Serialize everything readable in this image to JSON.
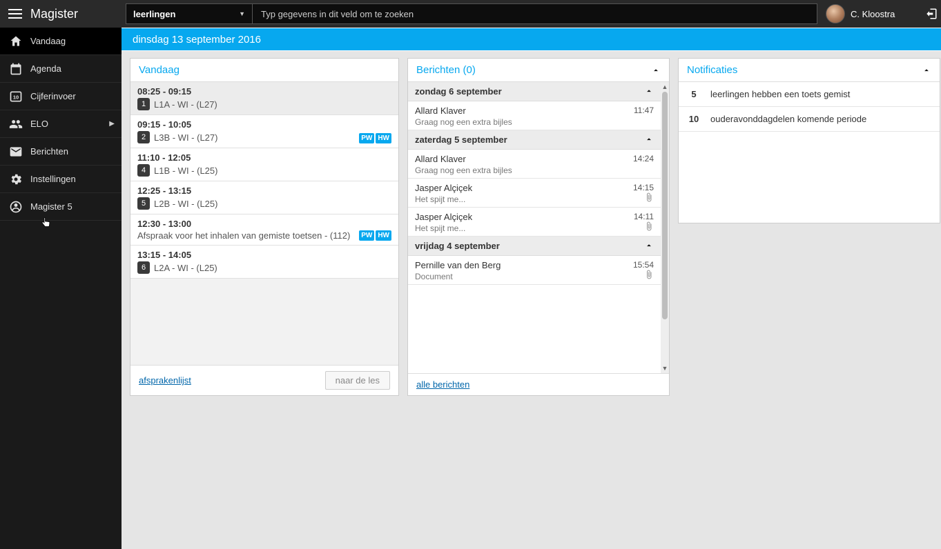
{
  "brand": "Magister",
  "sidebar": [
    {
      "id": "vandaag",
      "label": "Vandaag"
    },
    {
      "id": "agenda",
      "label": "Agenda"
    },
    {
      "id": "cijferinvoer",
      "label": "Cijferinvoer"
    },
    {
      "id": "elo",
      "label": "ELO"
    },
    {
      "id": "berichten",
      "label": "Berichten"
    },
    {
      "id": "instellingen",
      "label": "Instellingen"
    },
    {
      "id": "magister5",
      "label": "Magister 5"
    }
  ],
  "search": {
    "select": "leerlingen",
    "placeholder": "Typ gegevens in dit veld om te zoeken"
  },
  "user": {
    "name": "C. Kloostra"
  },
  "dateBar": "dinsdag 13 september 2016",
  "vandaag": {
    "title": "Vandaag",
    "items": [
      {
        "time": "08:25 - 09:15",
        "hour": "1",
        "desc": "L1A - WI - (L27)",
        "selected": true,
        "tags": []
      },
      {
        "time": "09:15 - 10:05",
        "hour": "2",
        "desc": "L3B - WI - (L27)",
        "tags": [
          "PW",
          "HW"
        ]
      },
      {
        "time": "11:10 - 12:05",
        "hour": "4",
        "desc": "L1B - WI - (L25)",
        "tags": []
      },
      {
        "time": "12:25 - 13:15",
        "hour": "5",
        "desc": "L2B - WI - (L25)",
        "tags": []
      },
      {
        "time": "12:30 - 13:00",
        "hour": "",
        "desc": "Afspraak voor het inhalen van gemiste toetsen - (112)",
        "tags": [
          "PW",
          "HW"
        ]
      },
      {
        "time": "13:15 - 14:05",
        "hour": "6",
        "desc": "L2A - WI - (L25)",
        "tags": []
      }
    ],
    "footerLink": "afsprakenlijst",
    "footerButton": "naar de les"
  },
  "berichten": {
    "title": "Berichten (0)",
    "days": [
      {
        "day": "zondag 6 september",
        "msgs": [
          {
            "from": "Allard Klaver",
            "time": "11:47",
            "body": "Graag nog een extra bijles",
            "att": false
          }
        ]
      },
      {
        "day": "zaterdag 5 september",
        "msgs": [
          {
            "from": "Allard Klaver",
            "time": "14:24",
            "body": "Graag nog een extra bijles",
            "att": false
          },
          {
            "from": "Jasper Alçiçek",
            "time": "14:15",
            "body": "Het spijt me...",
            "att": true
          },
          {
            "from": "Jasper Alçiçek",
            "time": "14:11",
            "body": "Het spijt me...",
            "att": true
          }
        ]
      },
      {
        "day": "vrijdag 4 september",
        "msgs": [
          {
            "from": "Pernille van den Berg",
            "time": "15:54",
            "body": "Document",
            "att": true
          }
        ]
      }
    ],
    "footerLink": "alle berichten"
  },
  "notificaties": {
    "title": "Notificaties",
    "items": [
      {
        "count": "5",
        "text": "leerlingen hebben een toets gemist"
      },
      {
        "count": "10",
        "text": "ouderavonddagdelen komende periode"
      }
    ]
  }
}
